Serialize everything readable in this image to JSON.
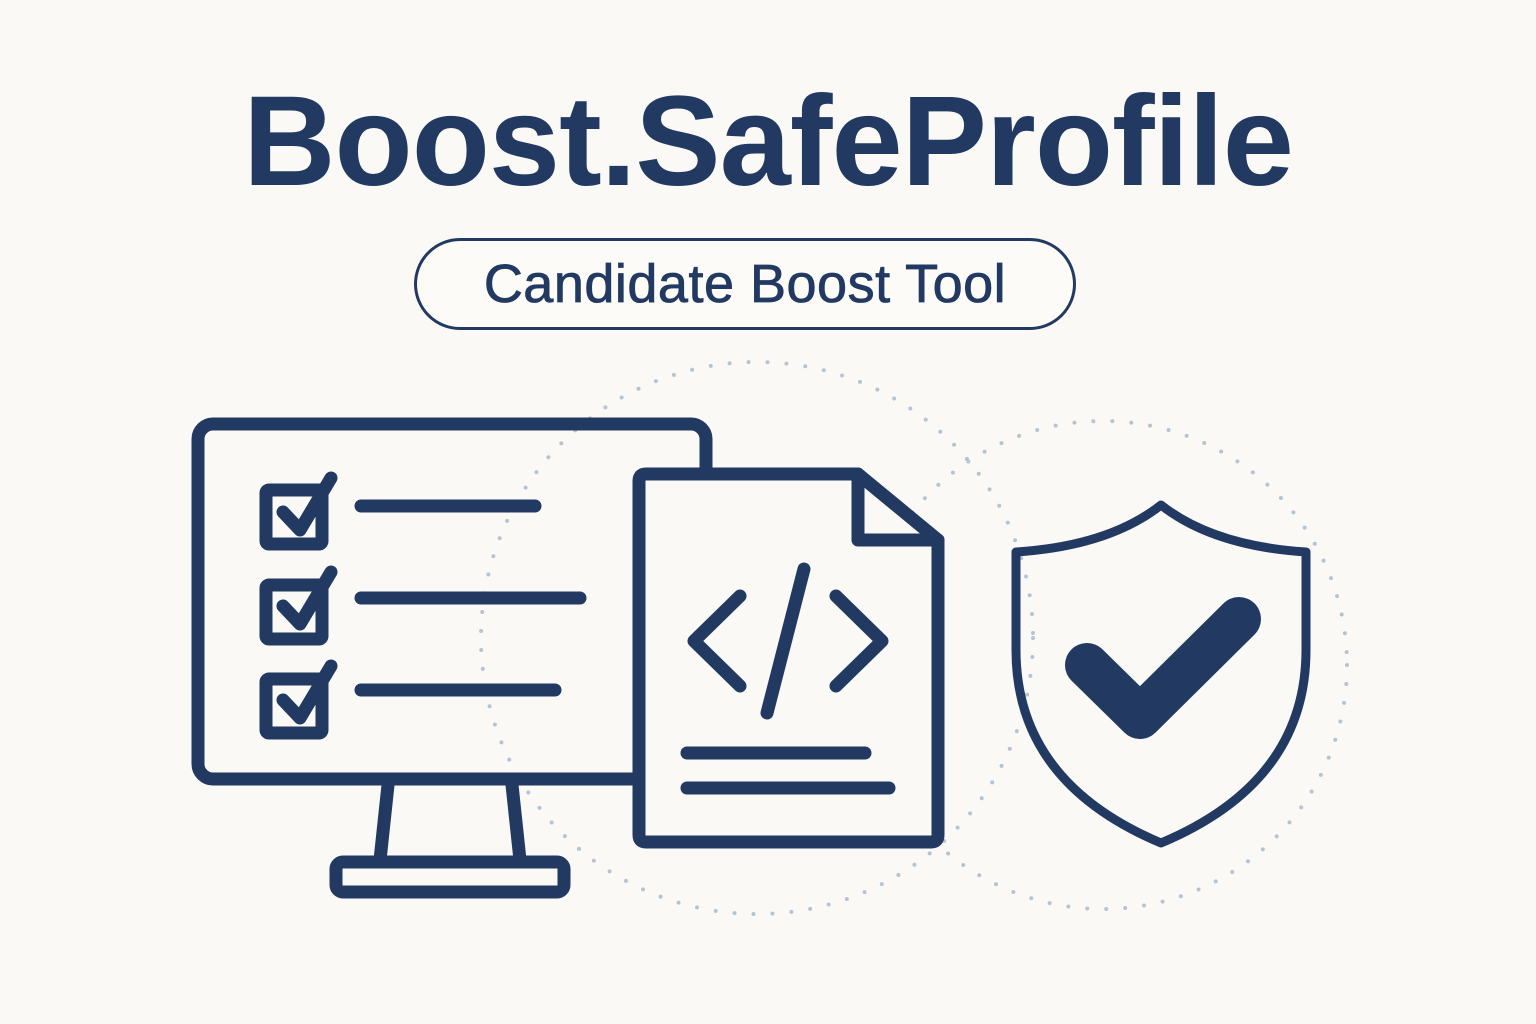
{
  "brand": {
    "title": "Boost.SafeProfile",
    "tagline": "Candidate Boost Tool",
    "color": "#223a62",
    "dot_color": "#aebfcf",
    "background": "#faf9f6"
  },
  "illustration": {
    "icons": [
      "monitor-checklist-icon",
      "code-file-icon",
      "shield-check-icon"
    ],
    "checklist_checked": [
      true,
      true,
      true
    ]
  }
}
